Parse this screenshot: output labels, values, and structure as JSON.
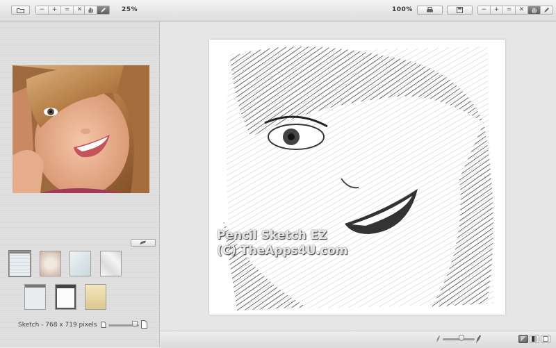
{
  "toolbar": {
    "open_icon": "folder-icon",
    "left_zoom_buttons": [
      "−",
      "+",
      "=",
      "✕"
    ],
    "hand_icon": "hand-icon",
    "pencil_icon": "pencil-icon",
    "left_zoom_value": "25%",
    "right_zoom_value": "100%",
    "print_icon": "print-icon",
    "save_icon": "save-icon",
    "right_zoom_buttons": [
      "−",
      "+",
      "=",
      "✕"
    ],
    "right_hand_icon": "hand-icon",
    "right_pencil_icon": "pencil-icon"
  },
  "left_panel": {
    "pencil_tool_icon": "pencil-icon",
    "papers": [
      {
        "name": "spiral-notebook",
        "color": "#e7edf0"
      },
      {
        "name": "aged-paper",
        "color": "#e3d7cc"
      },
      {
        "name": "blue-paper",
        "color": "#dfe8ec"
      },
      {
        "name": "white-crumpled",
        "color": "#f3f3f3"
      },
      {
        "name": "clipboard-grey",
        "color": "#e8ecef"
      },
      {
        "name": "clipboard-white",
        "color": "#f7f7f7"
      },
      {
        "name": "cream-paper",
        "color": "#eadcae"
      }
    ],
    "size_text": "Sketch - 768 x 719 pixels"
  },
  "canvas": {
    "watermark_line1": "Pencil Sketch EZ",
    "watermark_line2": "(C) TheApps4U.com"
  },
  "colors": {
    "toolbar_bg": "#e4e4e4",
    "panel_bg": "#e3e3e3",
    "sketch_bg": "#ffffff"
  }
}
